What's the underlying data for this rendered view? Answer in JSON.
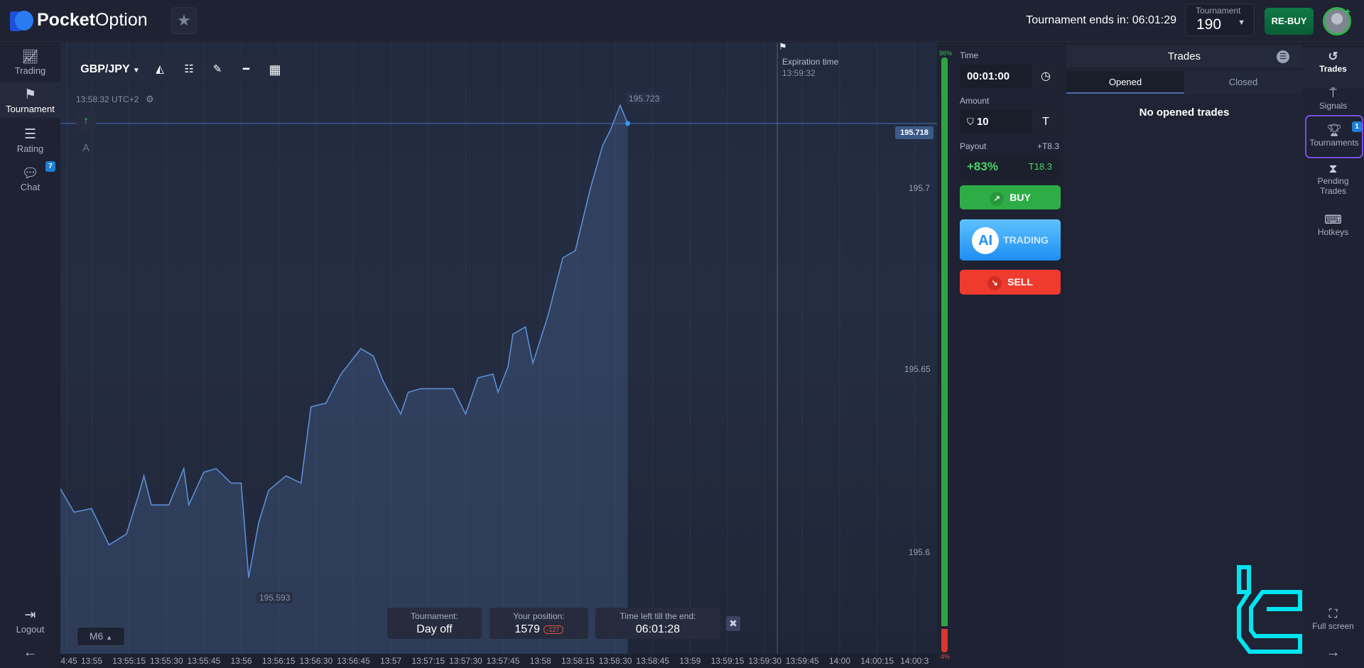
{
  "header": {
    "brand": {
      "bold": "Pocket",
      "light": "Option"
    },
    "tournament_ends_label": "Tournament ends in: 06:01:29",
    "tournament_select": {
      "label": "Tournament",
      "value": "190"
    },
    "rebuy_label": "RE-BUY"
  },
  "left_sidebar": {
    "items": [
      {
        "label": "Trading",
        "icon": "chart-line-icon"
      },
      {
        "label": "Tournament",
        "icon": "checkered-flag-icon",
        "active": true
      },
      {
        "label": "Rating",
        "icon": "list-icon"
      },
      {
        "label": "Chat",
        "icon": "chat-icon",
        "badge": "7"
      }
    ],
    "logout_label": "Logout"
  },
  "chart": {
    "asset": "GBP/JPY",
    "clock": "13:58:32 UTC+2",
    "indicator_letter": "A",
    "high_label": "195.723",
    "low_label": "195.593",
    "current_price": "195.718",
    "expiration": {
      "label": "Expiration time",
      "time": "13:59:32"
    },
    "timeframe": "M6",
    "price_labels": [
      "195.7",
      "195.65",
      "195.6"
    ],
    "sentiment": {
      "up": "96%",
      "down": "4%",
      "up_value": 96,
      "down_value": 4,
      "up_color": "#2fa541",
      "down_color": "#d9372e"
    },
    "info_bar": {
      "tournament_label": "Tournament:",
      "tournament_value": "Day off",
      "position_label": "Your position:",
      "position_value": "1579",
      "position_change": "-127",
      "time_left_label": "Time left till the end:",
      "time_left_value": "06:01:28"
    }
  },
  "chart_data": {
    "type": "area",
    "xlabel": "",
    "ylabel": "",
    "x_ticks": [
      "4:45",
      "13:55",
      "13:55:15",
      "13:55:30",
      "13:55:45",
      "13:56",
      "13:56:15",
      "13:56:30",
      "13:56:45",
      "13:57",
      "13:57:15",
      "13:57:30",
      "13:57:45",
      "13:58",
      "13:58:15",
      "13:58:30",
      "13:58:45",
      "13:59",
      "13:59:15",
      "13:59:30",
      "13:59:45",
      "14:00",
      "14:00:15",
      "14:00:3"
    ],
    "y_ticks": [
      195.7,
      195.65,
      195.6
    ],
    "line_color": "#5b8fd6",
    "points": [
      [
        "13:54:44",
        195.618
      ],
      [
        "13:54:50",
        195.611
      ],
      [
        "13:54:57",
        195.612
      ],
      [
        "13:55:04",
        195.602
      ],
      [
        "13:55:11",
        195.605
      ],
      [
        "13:55:16",
        195.616
      ],
      [
        "13:55:18",
        195.621
      ],
      [
        "13:55:21",
        195.613
      ],
      [
        "13:55:28",
        195.613
      ],
      [
        "13:55:34",
        195.623
      ],
      [
        "13:55:36",
        195.613
      ],
      [
        "13:55:42",
        195.622
      ],
      [
        "13:55:47",
        195.623
      ],
      [
        "13:55:53",
        195.619
      ],
      [
        "13:55:57",
        195.619
      ],
      [
        "13:56:00",
        195.593
      ],
      [
        "13:56:04",
        195.608
      ],
      [
        "13:56:08",
        195.617
      ],
      [
        "13:56:15",
        195.621
      ],
      [
        "13:56:21",
        195.619
      ],
      [
        "13:56:25",
        195.64
      ],
      [
        "13:56:31",
        195.641
      ],
      [
        "13:56:37",
        195.649
      ],
      [
        "13:56:45",
        195.656
      ],
      [
        "13:56:50",
        195.654
      ],
      [
        "13:56:54",
        195.647
      ],
      [
        "13:57:01",
        195.638
      ],
      [
        "13:57:04",
        195.644
      ],
      [
        "13:57:09",
        195.645
      ],
      [
        "13:57:16",
        195.645
      ],
      [
        "13:57:22",
        195.645
      ],
      [
        "13:57:27",
        195.638
      ],
      [
        "13:57:32",
        195.648
      ],
      [
        "13:57:38",
        195.649
      ],
      [
        "13:57:40",
        195.644
      ],
      [
        "13:57:44",
        195.651
      ],
      [
        "13:57:46",
        195.66
      ],
      [
        "13:57:51",
        195.662
      ],
      [
        "13:57:54",
        195.652
      ],
      [
        "13:58:00",
        195.665
      ],
      [
        "13:58:06",
        195.681
      ],
      [
        "13:58:11",
        195.683
      ],
      [
        "13:58:17",
        195.7
      ],
      [
        "13:58:22",
        195.712
      ],
      [
        "13:58:25",
        195.716
      ],
      [
        "13:58:29",
        195.723
      ],
      [
        "13:58:32",
        195.718
      ]
    ]
  },
  "trade_panel": {
    "time_label": "Time",
    "time_value": "00:01:00",
    "amount_label": "Amount",
    "amount_value": "10",
    "currency": "T",
    "payout_label": "Payout",
    "payout_profit": "+T8.3",
    "payout_percent": "+83%",
    "payout_total": "T18.3",
    "buy_label": "BUY",
    "ai_badge": "AI",
    "ai_label": "TRADING",
    "sell_label": "SELL",
    "colors": {
      "buy": "#2ead46",
      "sell": "#ef3a2e",
      "ai": "#2a9cf5"
    }
  },
  "trades_panel": {
    "title": "Trades",
    "tabs": [
      {
        "label": "Opened",
        "active": true
      },
      {
        "label": "Closed"
      }
    ],
    "empty_text": "No opened trades"
  },
  "right_sidebar": {
    "items": [
      {
        "label": "Trades",
        "icon": "history-icon",
        "active": true
      },
      {
        "label": "Signals",
        "icon": "signal-icon"
      },
      {
        "label": "Tournaments",
        "icon": "trophy-icon",
        "badge": "1"
      },
      {
        "label": "Pending Trades",
        "icon": "hourglass-icon"
      },
      {
        "label": "Hotkeys",
        "icon": "keyboard-icon"
      }
    ],
    "fullscreen_label": "Full screen"
  }
}
